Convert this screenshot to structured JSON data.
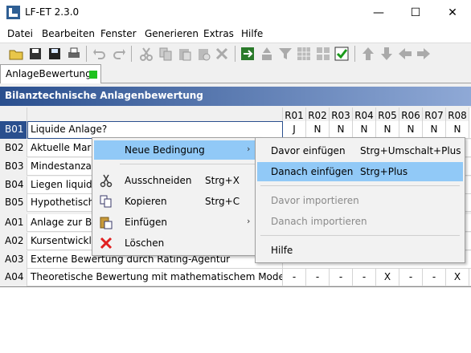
{
  "window": {
    "title": "LF-ET 2.3.0",
    "minimize": "—",
    "maximize": "☐",
    "close": "✕"
  },
  "menubar": [
    "Datei",
    "Bearbeiten",
    "Fenster",
    "Generieren",
    "Extras",
    "Hilfe"
  ],
  "toolbar": {
    "icons": [
      "open-folder-icon",
      "save-icon",
      "save-as-icon",
      "print-icon",
      "undo-icon",
      "redo-icon",
      "cut-icon",
      "copy-icon",
      "paste-icon",
      "paste-special-icon",
      "delete-icon",
      "table-export-icon",
      "insert-icon",
      "filter-icon",
      "grid-icon",
      "grid-alt-icon",
      "check-icon",
      "arrow-up-icon",
      "arrow-down-icon",
      "arrow-left-icon",
      "arrow-right-icon"
    ]
  },
  "tab": {
    "label": "AnlageBewertung",
    "status_color": "#1ec21e"
  },
  "table": {
    "title": "Bilanztechnische Anlagenbewertung",
    "rule_headers": [
      "R01",
      "R02",
      "R03",
      "R04",
      "R05",
      "R06",
      "R07",
      "R08"
    ],
    "conditions": [
      {
        "id": "B01",
        "text": "Liquide Anlage?",
        "values": [
          "J",
          "N",
          "N",
          "N",
          "N",
          "N",
          "N",
          "N"
        ]
      },
      {
        "id": "B02",
        "text": "Aktuelle Mark",
        "values": [
          "",
          "",
          "",
          "",
          "",
          "",
          "",
          ""
        ]
      },
      {
        "id": "B03",
        "text": "Mindestanzah",
        "values": [
          "",
          "",
          "",
          "",
          "",
          "",
          "",
          ""
        ]
      },
      {
        "id": "B04",
        "text": "Liegen liquide",
        "values": [
          "",
          "",
          "",
          "",
          "",
          "",
          "",
          ""
        ]
      },
      {
        "id": "B05",
        "text": "Hypothetische",
        "values": [
          "",
          "",
          "",
          "",
          "",
          "",
          "",
          ""
        ]
      }
    ],
    "actions": [
      {
        "id": "A01",
        "text": "Anlage zur Be",
        "values": [
          "",
          "",
          "",
          "",
          "",
          "",
          "",
          ""
        ]
      },
      {
        "id": "A02",
        "text": "Kursentwicklu",
        "values": [
          "",
          "",
          "",
          "",
          "",
          "",
          "",
          ""
        ]
      },
      {
        "id": "A03",
        "text": "Externe Bewertung durch Rating-Agentur",
        "values": [
          "",
          "",
          "",
          "",
          "",
          "",
          "",
          ""
        ]
      },
      {
        "id": "A04",
        "text": "Theoretische Bewertung mit mathematischem Modell",
        "values": [
          "-",
          "-",
          "-",
          "-",
          "X",
          "-",
          "-",
          "X"
        ]
      }
    ]
  },
  "context_menu": {
    "items": [
      {
        "label": "Neue Bedingung",
        "shortcut": "",
        "submenu": "›",
        "icon": ""
      },
      {
        "label": "Ausschneiden",
        "shortcut": "Strg+X",
        "submenu": "",
        "icon": "scissors-icon"
      },
      {
        "label": "Kopieren",
        "shortcut": "Strg+C",
        "submenu": "",
        "icon": "copy-icon"
      },
      {
        "label": "Einfügen",
        "shortcut": "",
        "submenu": "›",
        "icon": "paste-icon"
      },
      {
        "label": "Löschen",
        "shortcut": "",
        "submenu": "",
        "icon": "delete-x-icon"
      }
    ]
  },
  "submenu": {
    "items": [
      {
        "label": "Davor einfügen",
        "shortcut": "Strg+Umschalt+Plus"
      },
      {
        "label": "Danach einfügen",
        "shortcut": "Strg+Plus"
      },
      {
        "label": "Davor importieren",
        "shortcut": ""
      },
      {
        "label": "Danach importieren",
        "shortcut": ""
      },
      {
        "label": "Hilfe",
        "shortcut": ""
      }
    ]
  }
}
